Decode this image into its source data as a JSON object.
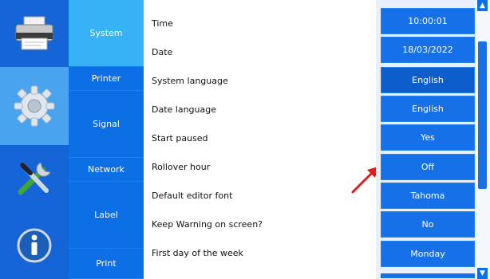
{
  "icons": {
    "printer": "printer-icon",
    "settings": "gear-icon",
    "tools": "tools-icon",
    "info": "info-icon"
  },
  "tabs": [
    {
      "label": "System",
      "active": true
    },
    {
      "label": "Printer",
      "active": false
    },
    {
      "label": "Signal",
      "active": false
    },
    {
      "label": "Network",
      "active": false
    },
    {
      "label": "Label",
      "active": false
    },
    {
      "label": "Print",
      "active": false
    }
  ],
  "settings": [
    {
      "label": "Time",
      "value": "10:00:01"
    },
    {
      "label": "Date",
      "value": "18/03/2022"
    },
    {
      "label": "System language",
      "value": "English"
    },
    {
      "label": "Date language",
      "value": "English"
    },
    {
      "label": "Start paused",
      "value": "Yes"
    },
    {
      "label": "Rollover hour",
      "value": "Off"
    },
    {
      "label": "Default editor font",
      "value": "Tahoma"
    },
    {
      "label": "Keep Warning on screen?",
      "value": "No"
    },
    {
      "label": "First day of the week",
      "value": "Monday"
    }
  ],
  "colors": {
    "primary_blue": "#1670e8",
    "active_tab": "#36b3f7",
    "annotation_arrow": "#e01b1b"
  },
  "scrollbar": {
    "up_glyph": "▲",
    "down_glyph": "▼"
  }
}
